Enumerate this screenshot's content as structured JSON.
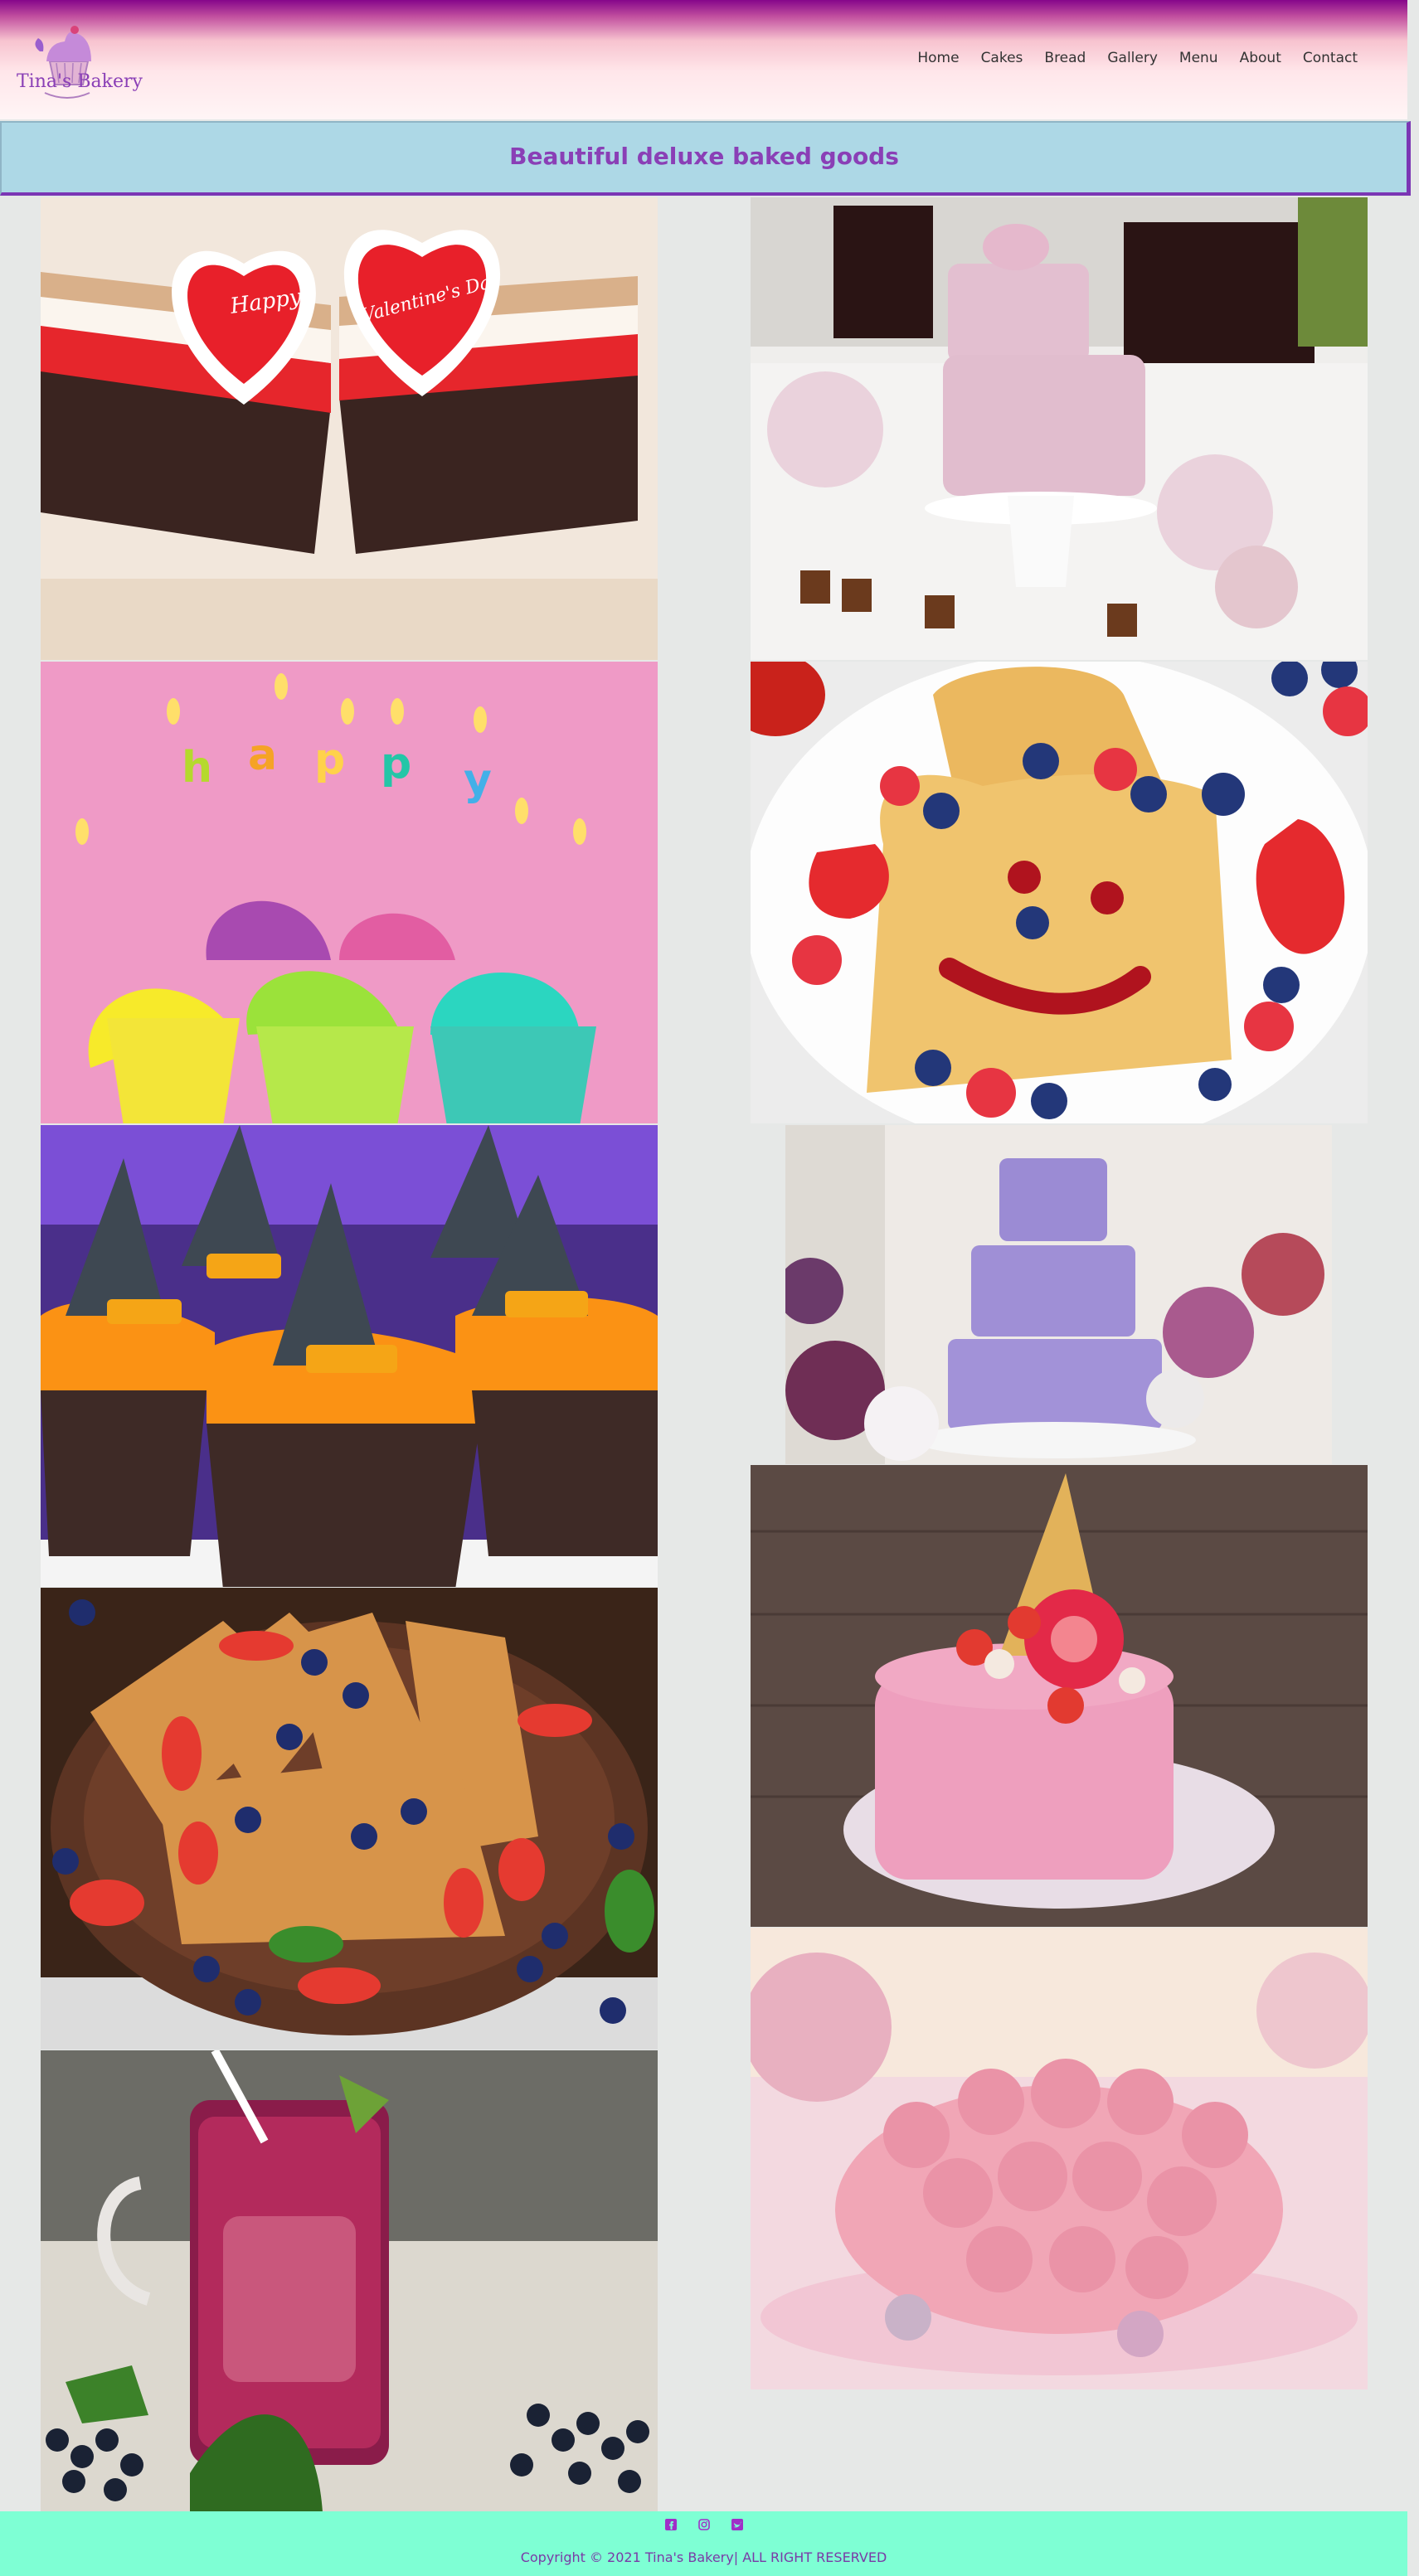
{
  "brand": {
    "name": "Tina's Bakery"
  },
  "nav": {
    "items": [
      "Home",
      "Cakes",
      "Bread",
      "Gallery",
      "Menu",
      "About",
      "Contact"
    ]
  },
  "banner": {
    "title": "Beautiful deluxe baked goods"
  },
  "gallery": {
    "images": [
      {
        "name": "valentine-cake-bars-image",
        "caption_left": "Happy",
        "caption_right": "Valentine's Day"
      },
      {
        "name": "pink-wedding-cake-table-image"
      },
      {
        "name": "happy-birthday-cupcakes-image"
      },
      {
        "name": "smiley-toast-berries-image"
      },
      {
        "name": "halloween-witch-cupcakes-image"
      },
      {
        "name": "lavender-tiered-cake-image"
      },
      {
        "name": "crepes-berries-image"
      },
      {
        "name": "pink-ice-cream-cake-image"
      },
      {
        "name": "berry-smoothie-jar-image"
      },
      {
        "name": "pink-rose-cake-image"
      }
    ]
  },
  "footer": {
    "social": [
      "facebook-icon",
      "instagram-icon",
      "twitter-icon"
    ],
    "copyright": "Copyright  © 2021 Tina's Bakery| ALL RIGHT RESERVED"
  },
  "colors": {
    "accent": "#8a3fb6",
    "banner": "#add8e6",
    "footer": "#7effd4",
    "header_top": "#86068a"
  }
}
